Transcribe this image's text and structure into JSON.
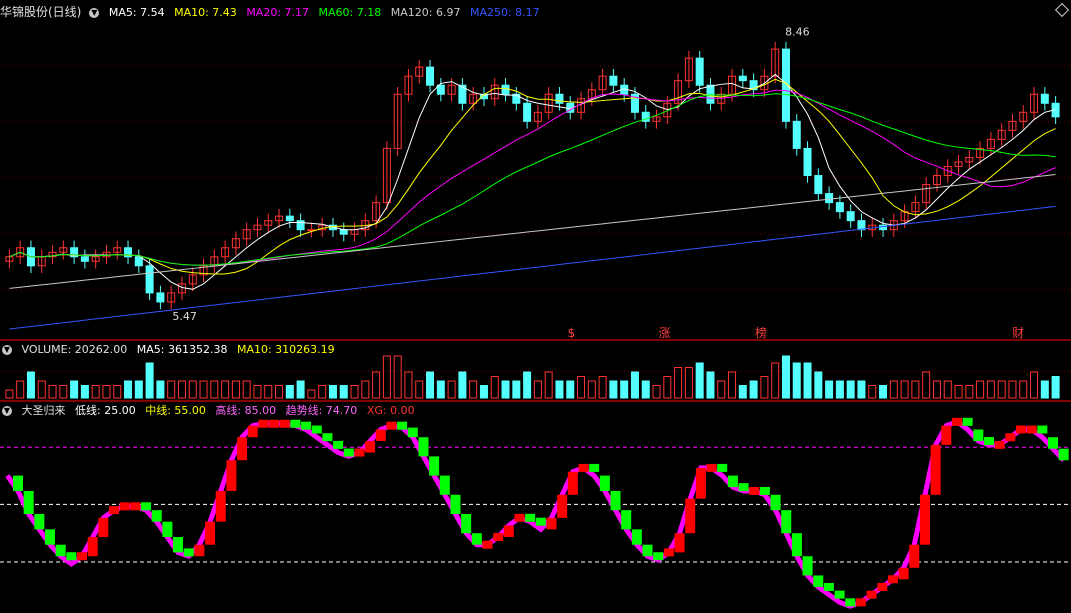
{
  "price_panel": {
    "stock": "华锦股份(日线)",
    "ma": [
      {
        "label": "MA5: 7.54",
        "color": "#ffffff"
      },
      {
        "label": "MA10: 7.43",
        "color": "#ffff00"
      },
      {
        "label": "MA20: 7.17",
        "color": "#ff00ff"
      },
      {
        "label": "MA60: 7.18",
        "color": "#00ff00"
      },
      {
        "label": "MA120: 6.97",
        "color": "#c8c8c8"
      },
      {
        "label": "MA250: 8.17",
        "color": "#3355ff"
      }
    ],
    "high_label": "8.46",
    "low_label": "5.47",
    "event_marks": [
      "$",
      "涨",
      "榜",
      "财"
    ]
  },
  "volume_panel": {
    "title": "VOLUME: 20262.00",
    "ma5": "MA5: 361352.38",
    "ma10": "MA10: 310263.19"
  },
  "indicator_panel": {
    "title": "大圣归来",
    "low": "低线: 25.00",
    "mid": "中线: 55.00",
    "high": "高线: 85.00",
    "trend": "趋势线: 74.70",
    "xg": "XG: 0.00",
    "levels": {
      "low": 25,
      "mid": 55,
      "high": 85
    }
  },
  "colors": {
    "up": "#ff3333",
    "down": "#54ffff",
    "panel_border": "#b00000",
    "trend_pink": "#ff00ff",
    "green_bar": "#00ff00"
  },
  "chart_data": {
    "type": "candlestick",
    "price_ylim": [
      5.3,
      8.6
    ],
    "price_close": [
      6.0,
      6.1,
      5.9,
      6.0,
      6.05,
      6.1,
      6.0,
      5.95,
      6.0,
      6.05,
      6.1,
      6.0,
      5.9,
      5.6,
      5.5,
      5.6,
      5.7,
      5.8,
      5.9,
      6.0,
      6.1,
      6.2,
      6.3,
      6.35,
      6.4,
      6.45,
      6.4,
      6.3,
      6.3,
      6.35,
      6.3,
      6.25,
      6.3,
      6.4,
      6.6,
      7.2,
      7.8,
      8.0,
      8.1,
      7.9,
      7.8,
      7.9,
      7.7,
      7.8,
      7.75,
      7.9,
      7.8,
      7.7,
      7.5,
      7.6,
      7.8,
      7.7,
      7.6,
      7.75,
      7.85,
      8.0,
      7.9,
      7.8,
      7.6,
      7.5,
      7.55,
      7.7,
      7.95,
      8.2,
      7.9,
      7.7,
      7.8,
      8.0,
      7.95,
      7.85,
      8.0,
      8.3,
      7.5,
      7.2,
      6.9,
      6.7,
      6.6,
      6.5,
      6.4,
      6.3,
      6.35,
      6.3,
      6.4,
      6.5,
      6.6,
      6.8,
      6.9,
      7.0,
      7.05,
      7.1,
      7.2,
      7.3,
      7.4,
      7.5,
      7.6,
      7.8,
      7.7,
      7.55
    ],
    "indicator_ylim": [
      0,
      100
    ],
    "indicator": [
      70,
      62,
      50,
      42,
      34,
      28,
      24,
      28,
      38,
      48,
      52,
      54,
      54,
      52,
      46,
      38,
      30,
      28,
      34,
      46,
      62,
      78,
      90,
      96,
      97,
      97,
      97,
      96,
      94,
      90,
      86,
      82,
      80,
      82,
      88,
      94,
      96,
      95,
      90,
      80,
      70,
      60,
      50,
      40,
      34,
      34,
      38,
      44,
      48,
      46,
      42,
      48,
      60,
      72,
      74,
      70,
      62,
      52,
      42,
      34,
      28,
      26,
      30,
      40,
      58,
      74,
      74,
      70,
      64,
      62,
      62,
      60,
      52,
      40,
      28,
      18,
      12,
      8,
      4,
      2,
      4,
      8,
      12,
      16,
      22,
      34,
      60,
      86,
      96,
      98,
      94,
      88,
      86,
      86,
      90,
      94,
      94,
      90,
      84,
      78
    ]
  }
}
